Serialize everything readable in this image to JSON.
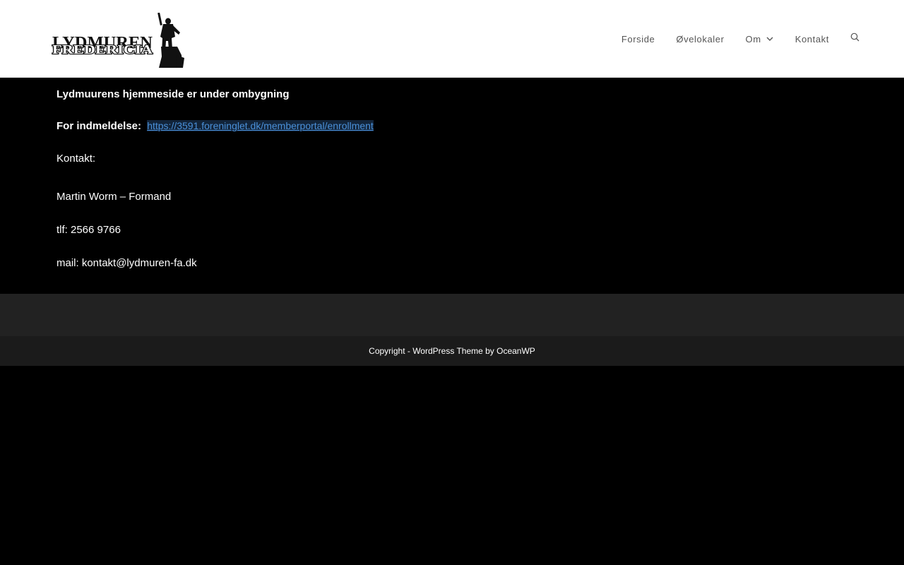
{
  "header": {
    "logo": {
      "line1": "LYDMUREN",
      "line2": "FREDERICIA"
    },
    "nav": {
      "items": [
        {
          "label": "Forside"
        },
        {
          "label": "Øvelokaler"
        },
        {
          "label": "Om",
          "has_dropdown": true
        },
        {
          "label": "Kontakt"
        }
      ],
      "search_icon": "search-icon"
    }
  },
  "main": {
    "title": "Lydmuurens hjemmeside er under ombygning",
    "enrollment_label": "For indmeldelse:",
    "enrollment_link": "https://3591.foreninglet.dk/memberportal/enrollment",
    "contact_heading": "Kontakt:",
    "contact_name": "Martin Worm – Formand",
    "contact_phone": "tlf: 2566 9766",
    "contact_mail": "mail: kontakt@lydmuren-fa.dk"
  },
  "footer": {
    "copyright": "Copyright - WordPress Theme by OceanWP"
  },
  "colors": {
    "page_background": "#000000",
    "header_background": "#ffffff",
    "nav_text": "#555555",
    "link": "#4a90d9",
    "footer_widgets": "#222222",
    "footer_bottom": "#1b1b1b"
  }
}
